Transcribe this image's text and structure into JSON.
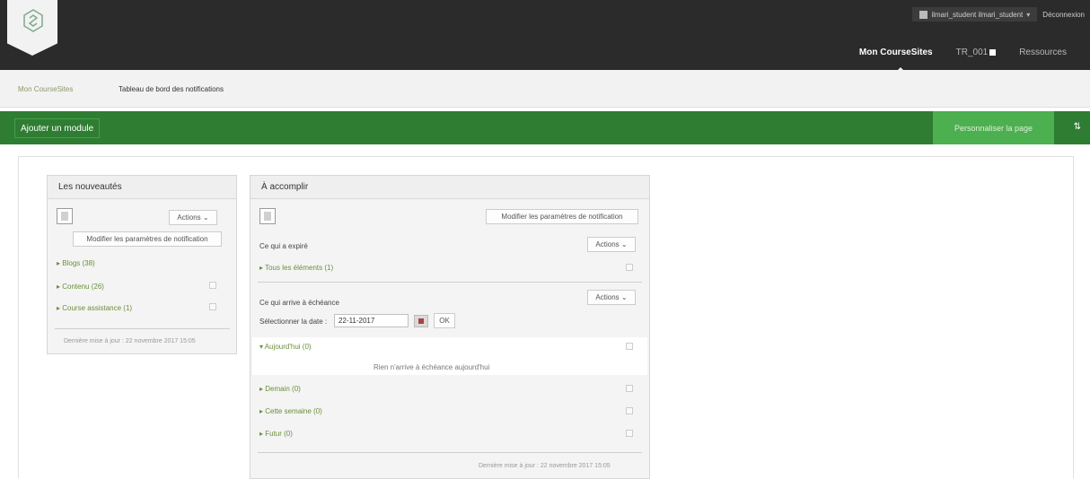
{
  "header": {
    "user_label": "ilmari_student ilmari_student",
    "logout_label": "Déconnexion",
    "nav": [
      "Mon CourseSites",
      "TR_001",
      "Ressources"
    ]
  },
  "breadcrumb": {
    "home": "Mon CourseSites",
    "current": "Tableau de bord des notifications"
  },
  "toolbar": {
    "add_module": "Ajouter un module",
    "customize": "Personnaliser la page",
    "swap": "⇅"
  },
  "news": {
    "title": "Les nouveautés",
    "actions": "Actions ⌄",
    "modify": "Modifier les paramètres de notification",
    "items": [
      "Blogs (38)",
      "Contenu (26)",
      "Course assistance (1)"
    ],
    "footer": "Dernière mise à jour : 22 novembre 2017 15:05"
  },
  "todo": {
    "title": "À accomplir",
    "modify": "Modifier les paramètres de notification",
    "expired_label": "Ce qui a expiré",
    "actions": "Actions ⌄",
    "all_items": "Tous les éléments (1)",
    "upcoming_label": "Ce qui arrive à échéance",
    "select_date_label": "Sélectionner la date :",
    "date_value": "22-11-2017",
    "go": "OK",
    "today": "Aujourd'hui (0)",
    "nothing_today": "Rien n'arrive à échéance aujourd'hui",
    "tomorrow": "Demain (0)",
    "this_week": "Cette semaine (0)",
    "future": "Futur (0)",
    "footer": "Dernière mise à jour : 22 novembre 2017 15:05"
  },
  "colors": {
    "topbar": "#2b2b2b",
    "green": "#2e7d32",
    "link_green": "#6a8f3a"
  }
}
